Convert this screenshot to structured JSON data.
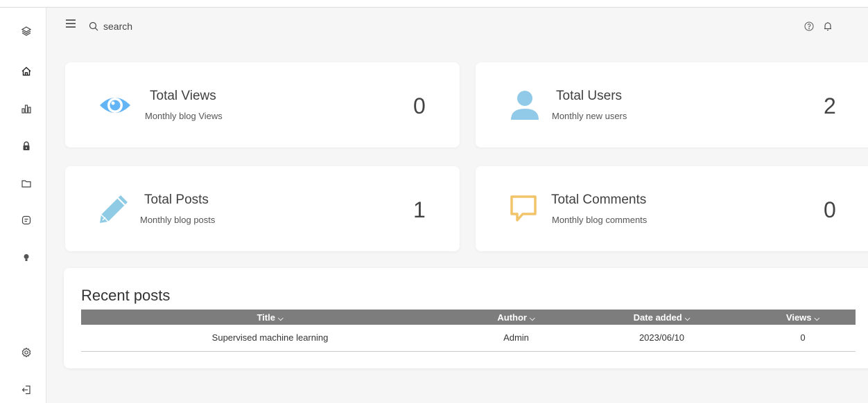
{
  "header": {
    "search_placeholder": "search"
  },
  "cards": {
    "views": {
      "title": "Total Views",
      "subtitle": "Monthly blog Views",
      "value": "0"
    },
    "users": {
      "title": "Total Users",
      "subtitle": "Monthly new users",
      "value": "2"
    },
    "posts": {
      "title": "Total Posts",
      "subtitle": "Monthly blog posts",
      "value": "1"
    },
    "comments": {
      "title": "Total Comments",
      "subtitle": "Monthly blog comments",
      "value": "0"
    }
  },
  "recent": {
    "title": "Recent posts",
    "columns": [
      "Title",
      "Author",
      "Date added",
      "Views"
    ],
    "rows": [
      [
        "Supervised machine learning",
        "Admin",
        "2023/06/10",
        "0"
      ]
    ]
  },
  "icons": {
    "sidebar": [
      "layers-icon",
      "home-icon",
      "chart-icon",
      "lock-icon",
      "folder-icon",
      "message-icon",
      "bulb-icon",
      "settings-icon",
      "logout-icon"
    ],
    "header": [
      "menu-icon",
      "search-icon",
      "help-icon",
      "bell-icon"
    ]
  },
  "colors": {
    "eye": "#64b5f6",
    "user": "#90cae8",
    "pencil": "#8fcbe4",
    "comment": "#f2c469",
    "table_header": "#7d7d7d"
  }
}
